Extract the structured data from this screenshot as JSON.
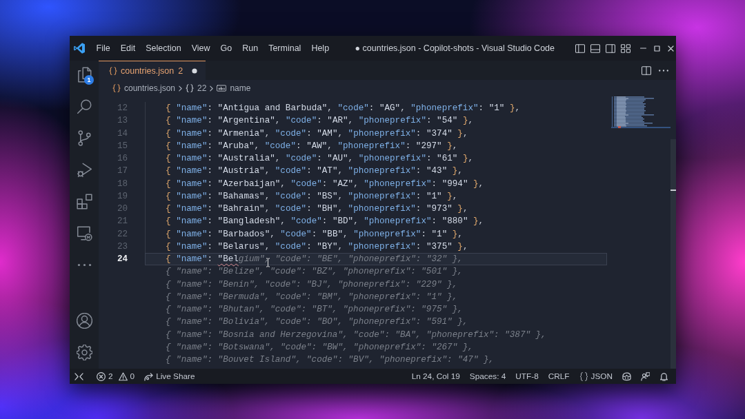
{
  "window": {
    "title": "● countries.json - Copilot-shots - Visual Studio Code"
  },
  "menu": [
    "File",
    "Edit",
    "Selection",
    "View",
    "Go",
    "Run",
    "Terminal",
    "Help"
  ],
  "activity_bar": {
    "badge": "1"
  },
  "tabs": [
    {
      "label": "countries.json",
      "problems": "2",
      "modified": true,
      "selected": true
    }
  ],
  "breadcrumbs": [
    {
      "kind": "file",
      "label": "countries.json"
    },
    {
      "kind": "object",
      "label": "22"
    },
    {
      "kind": "string",
      "label": "name"
    }
  ],
  "editor": {
    "lines": [
      {
        "number": "12",
        "text": "{ \"name\": \"Antigua and Barbuda\", \"code\": \"AG\", \"phoneprefix\": \"1\" },",
        "current": false,
        "error": false
      },
      {
        "number": "13",
        "text": "{ \"name\": \"Argentina\", \"code\": \"AR\", \"phoneprefix\": \"54\" },",
        "current": false,
        "error": false
      },
      {
        "number": "14",
        "text": "{ \"name\": \"Armenia\", \"code\": \"AM\", \"phoneprefix\": \"374\" },",
        "current": false,
        "error": false
      },
      {
        "number": "15",
        "text": "{ \"name\": \"Aruba\", \"code\": \"AW\", \"phoneprefix\": \"297\" },",
        "current": false,
        "error": false
      },
      {
        "number": "16",
        "text": "{ \"name\": \"Australia\", \"code\": \"AU\", \"phoneprefix\": \"61\" },",
        "current": false,
        "error": false
      },
      {
        "number": "17",
        "text": "{ \"name\": \"Austria\", \"code\": \"AT\", \"phoneprefix\": \"43\" },",
        "current": false,
        "error": false
      },
      {
        "number": "18",
        "text": "{ \"name\": \"Azerbaijan\", \"code\": \"AZ\", \"phoneprefix\": \"994\" },",
        "current": false,
        "error": false
      },
      {
        "number": "19",
        "text": "{ \"name\": \"Bahamas\", \"code\": \"BS\", \"phoneprefix\": \"1\" },",
        "current": false,
        "error": false
      },
      {
        "number": "20",
        "text": "{ \"name\": \"Bahrain\", \"code\": \"BH\", \"phoneprefix\": \"973\" },",
        "current": false,
        "error": false
      },
      {
        "number": "21",
        "text": "{ \"name\": \"Bangladesh\", \"code\": \"BD\", \"phoneprefix\": \"880\" },",
        "current": false,
        "error": false
      },
      {
        "number": "22",
        "text": "{ \"name\": \"Barbados\", \"code\": \"BB\", \"phoneprefix\": \"1\" },",
        "current": false,
        "error": false
      },
      {
        "number": "23",
        "text": "{ \"name\": \"Belarus\", \"code\": \"BY\", \"phoneprefix\": \"375\" },",
        "current": false,
        "error": false
      },
      {
        "number": "24",
        "text": "{ \"name\": \"Bel",
        "suggestion": "gium\", \"code\": \"BE\", \"phoneprefix\": \"32\" },",
        "current": true,
        "error": true
      }
    ],
    "suggestion_lines": [
      "{ \"name\": \"Belize\", \"code\": \"BZ\", \"phoneprefix\": \"501\" },",
      "{ \"name\": \"Benin\", \"code\": \"BJ\", \"phoneprefix\": \"229\" },",
      "{ \"name\": \"Bermuda\", \"code\": \"BM\", \"phoneprefix\": \"1\" },",
      "{ \"name\": \"Bhutan\", \"code\": \"BT\", \"phoneprefix\": \"975\" },",
      "{ \"name\": \"Bolivia\", \"code\": \"BO\", \"phoneprefix\": \"591\" },",
      "{ \"name\": \"Bosnia and Herzegovina\", \"code\": \"BA\", \"phoneprefix\": \"387\" },",
      "{ \"name\": \"Botswana\", \"code\": \"BW\", \"phoneprefix\": \"267\" },",
      "{ \"name\": \"Bouvet Island\", \"code\": \"BV\", \"phoneprefix\": \"47\" },"
    ]
  },
  "status_bar": {
    "left": [
      {
        "kind": "remote"
      },
      {
        "kind": "problems",
        "errors": "2",
        "warnings": "0"
      },
      {
        "kind": "live_share",
        "label": "Live Share"
      }
    ],
    "right": [
      {
        "kind": "text",
        "label": "Ln 24, Col 19"
      },
      {
        "kind": "text",
        "label": "Spaces: 4"
      },
      {
        "kind": "text",
        "label": "UTF-8"
      },
      {
        "kind": "text",
        "label": "CRLF"
      },
      {
        "kind": "language",
        "label": "JSON"
      },
      {
        "kind": "copilot"
      },
      {
        "kind": "feedback"
      },
      {
        "kind": "notifications"
      }
    ]
  }
}
